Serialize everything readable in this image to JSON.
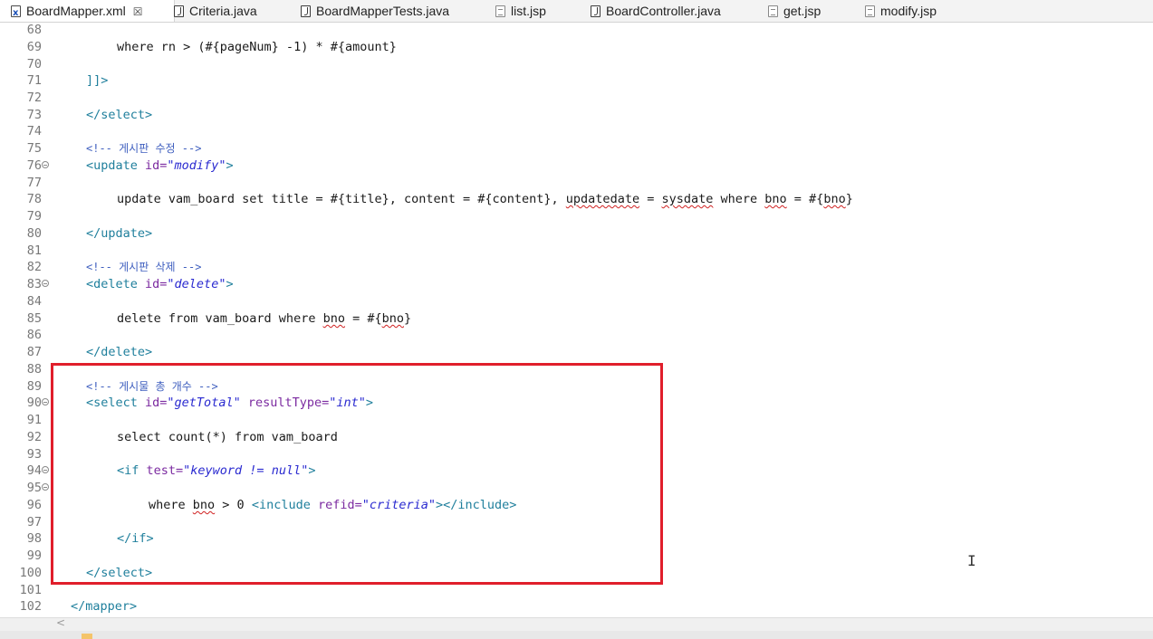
{
  "tabs": [
    {
      "label": "BoardMapper.xml",
      "icon": "xml-file-icon",
      "active": true,
      "close": "☒"
    },
    {
      "label": "Criteria.java",
      "icon": "java-file-icon"
    },
    {
      "label": "BoardMapperTests.java",
      "icon": "java-file-icon"
    },
    {
      "label": "list.jsp",
      "icon": "jsp-file-icon"
    },
    {
      "label": "BoardController.java",
      "icon": "java-file-icon"
    },
    {
      "label": "get.jsp",
      "icon": "jsp-file-icon"
    },
    {
      "label": "modify.jsp",
      "icon": "jsp-file-icon"
    }
  ],
  "editor": {
    "lines": {
      "l68": "68",
      "l69": "69",
      "l70": "70",
      "l71": "71",
      "l72": "72",
      "l73": "73",
      "l74": "74",
      "l75": "75",
      "l76": "76",
      "l77": "77",
      "l78": "78",
      "l79": "79",
      "l80": "80",
      "l81": "81",
      "l82": "82",
      "l83": "83",
      "l84": "84",
      "l85": "85",
      "l86": "86",
      "l87": "87",
      "l88": "88",
      "l89": "89",
      "l90": "90",
      "l91": "91",
      "l92": "92",
      "l93": "93",
      "l94": "94",
      "l95": "95",
      "l96": "96",
      "l97": "97",
      "l98": "98",
      "l99": "99",
      "l100": "100",
      "l101": "101",
      "l102": "102"
    },
    "code": {
      "c69": "where rn > (#{pageNum} -1) * #{amount}",
      "c71": "]]>",
      "c73": "</select>",
      "c75": "<!-- 게시판 수정 -->",
      "c76_open": "<update ",
      "c76_attr": "id=",
      "c76_val": "\"modify\"",
      "c76_close": ">",
      "c78_a": "update vam_board set title = #{title}, content = #{content}, ",
      "c78_b": "updatedate",
      "c78_c": " = ",
      "c78_d": "sysdate",
      "c78_e": " where ",
      "c78_f": "bno",
      "c78_g": " = #{",
      "c78_h": "bno",
      "c78_i": "}",
      "c80": "</update>",
      "c82": "<!-- 게시판 삭제 -->",
      "c83_open": "<delete ",
      "c83_attr": "id=",
      "c83_val": "\"delete\"",
      "c83_close": ">",
      "c85_a": "delete from vam_board where ",
      "c85_b": "bno",
      "c85_c": " = #{",
      "c85_d": "bno",
      "c85_e": "}",
      "c87": "</delete>",
      "c89": "<!-- 게시물 총 개수 -->",
      "c90_open": "<select ",
      "c90_attr1": "id=",
      "c90_val1": "\"getTotal\"",
      "c90_attr2": " resultType=",
      "c90_val2": "\"int\"",
      "c90_close": ">",
      "c92": "select count(*) from vam_board",
      "c94_open": "<if ",
      "c94_attr": "test=",
      "c94_val": "\"keyword != null\"",
      "c94_close": ">",
      "c96_a": "where ",
      "c96_b": "bno",
      "c96_c": " > 0 ",
      "c96_open": "<include ",
      "c96_attr": "refid=",
      "c96_val": "\"criteria\"",
      "c96_close": "></include>",
      "c98": "</if>",
      "c100": "</select>",
      "c102": "</mapper>"
    }
  },
  "colors": {
    "tag": "#1f7f9c",
    "attribute": "#7b2aa0",
    "value": "#2a2ad0",
    "comment": "#3f5fbf",
    "highlight": "#e01e2b"
  }
}
